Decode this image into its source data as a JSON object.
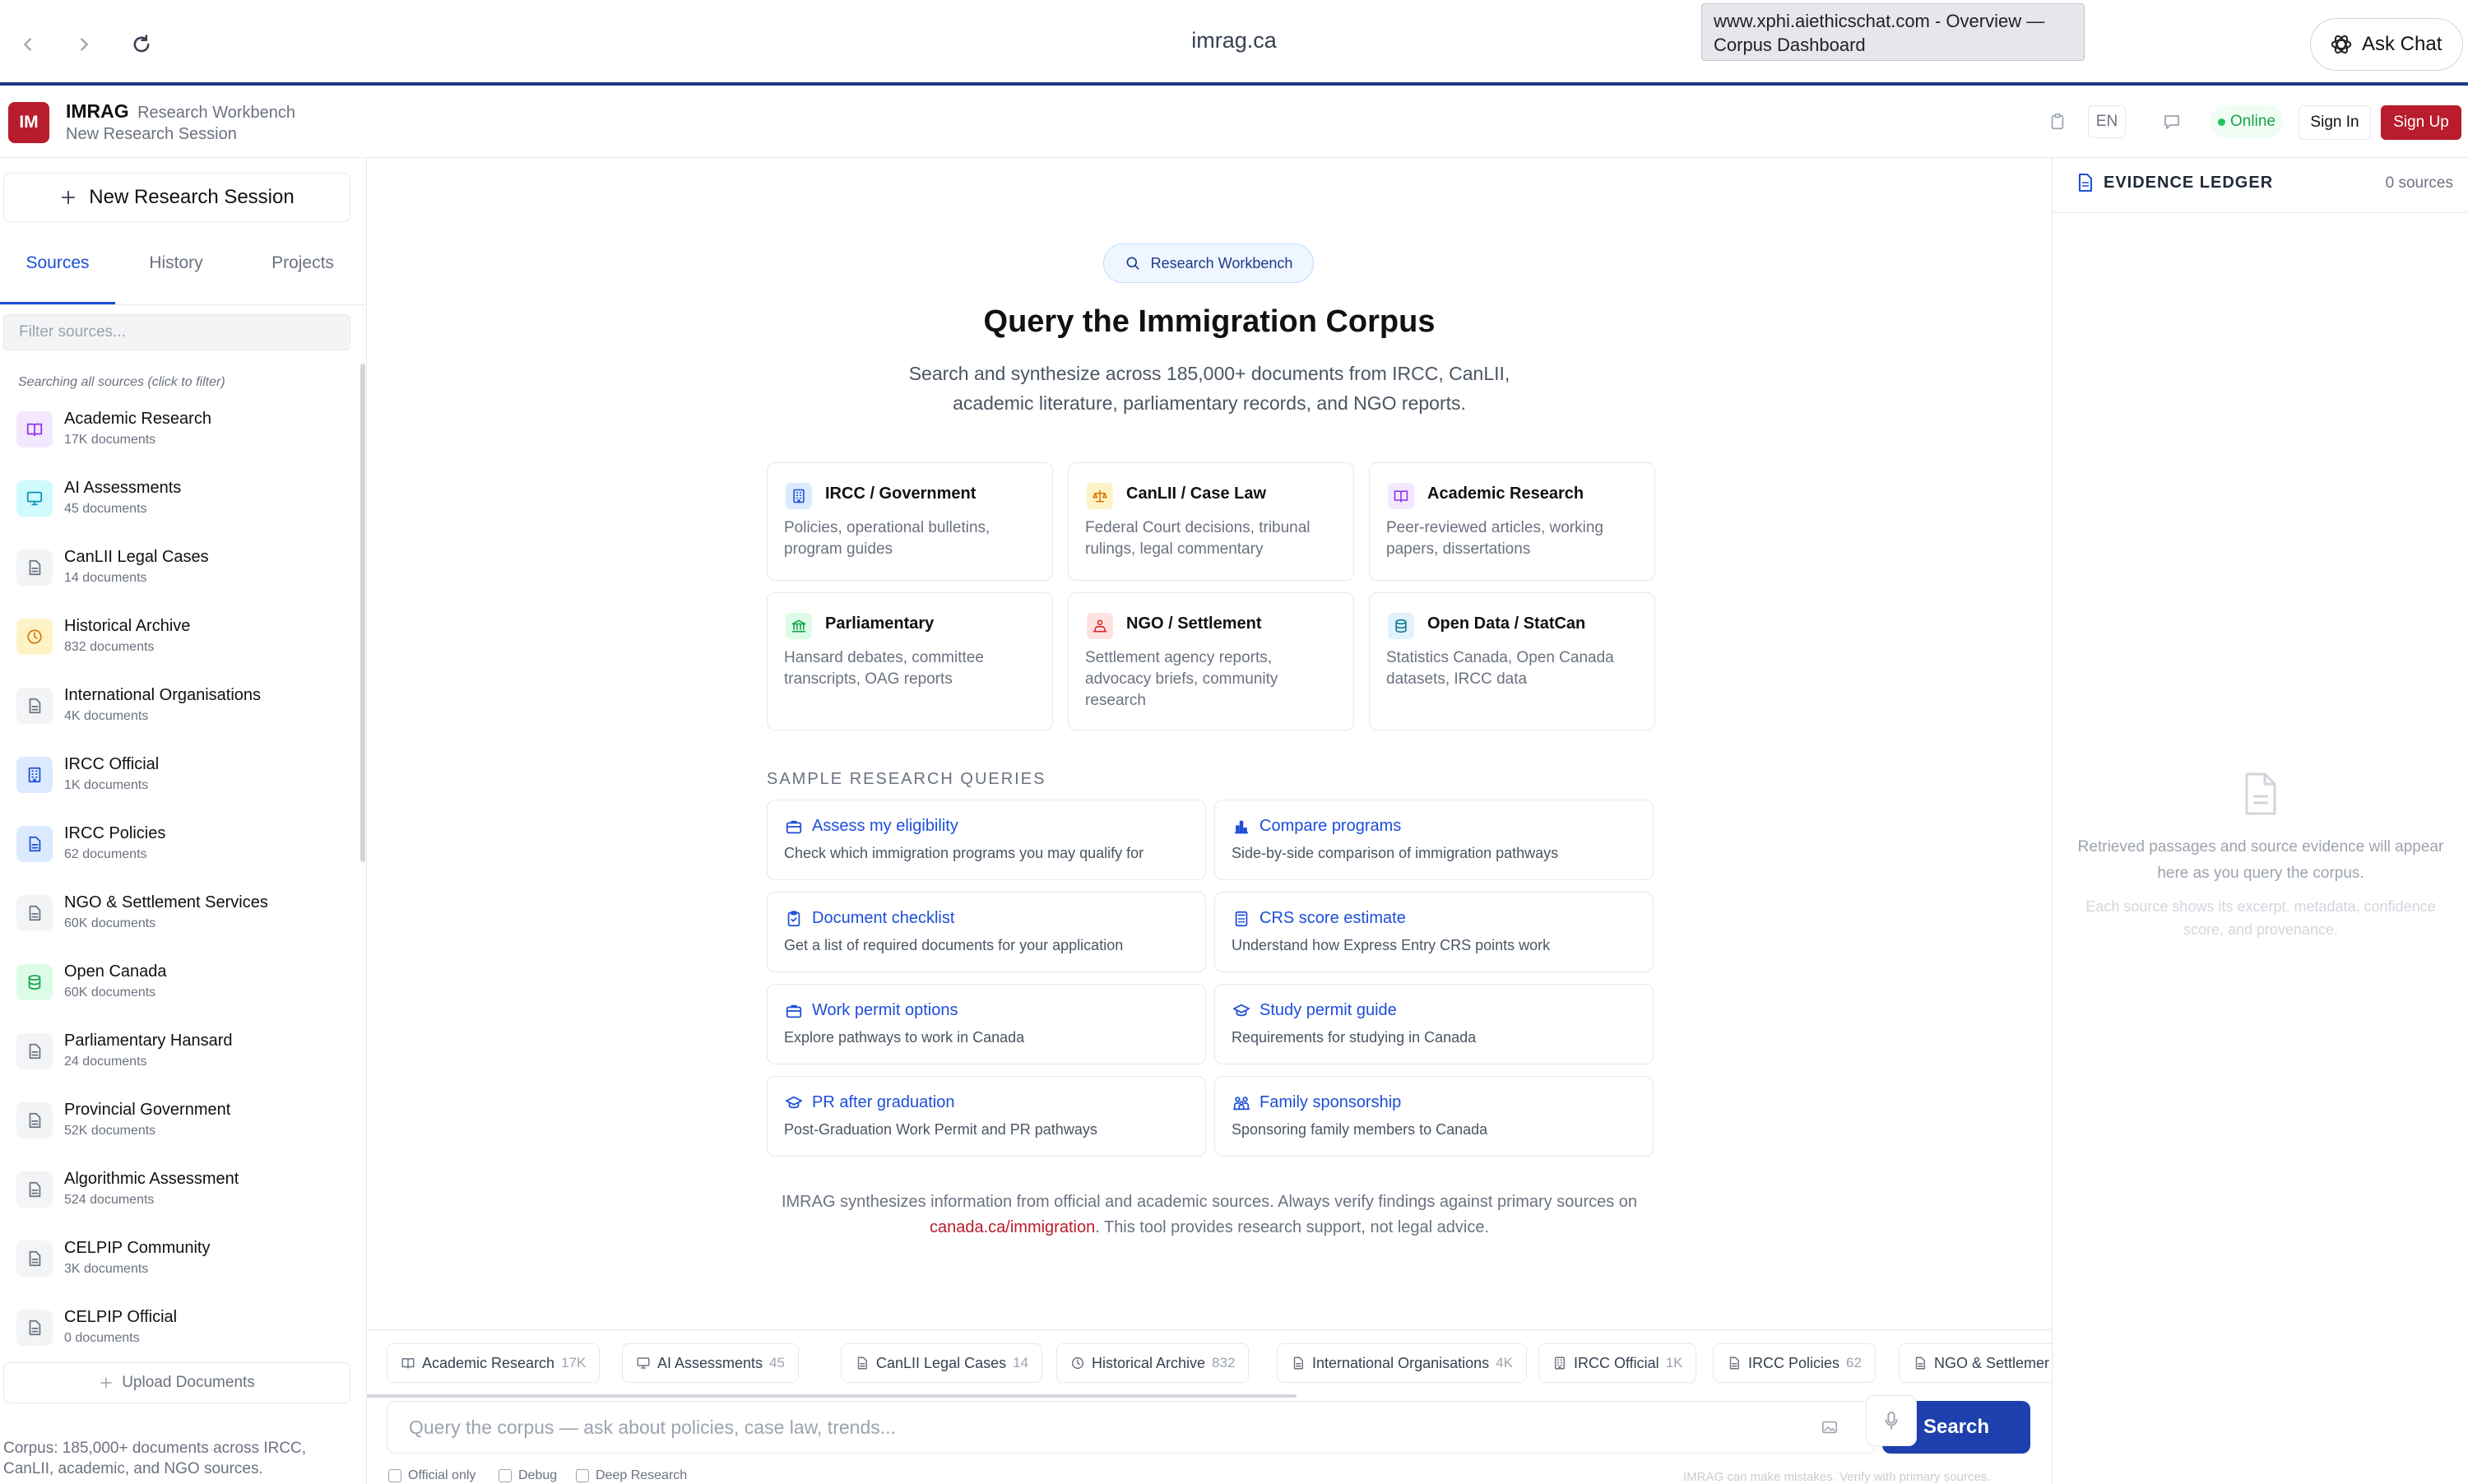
{
  "browser": {
    "url": "imrag.ca",
    "tooltip_line1": "www.xphi.aiethicschat.com - Overview —",
    "tooltip_line2": "Corpus Dashboard",
    "ask_chat_label": "Ask Chat"
  },
  "header": {
    "logo": "IM",
    "brand": "IMRAG",
    "brand_sub": "Research Workbench",
    "session_name": "New Research Session",
    "lang": "EN",
    "status": "Online",
    "sign_in": "Sign In",
    "sign_up": "Sign Up"
  },
  "sidebar": {
    "new_session_label": "New Research Session",
    "tabs": [
      "Sources",
      "History",
      "Projects"
    ],
    "filter_placeholder": "Filter sources...",
    "searching_note": "Searching all sources (click to filter)",
    "sources": [
      {
        "name": "Academic Research",
        "count": "17K documents",
        "icon": "book-icon",
        "color": "#9333ea",
        "bg": "#f3e8ff"
      },
      {
        "name": "AI Assessments",
        "count": "45 documents",
        "icon": "monitor-icon",
        "color": "#0891b2",
        "bg": "#cffafe"
      },
      {
        "name": "CanLII Legal Cases",
        "count": "14 documents",
        "icon": "document-icon",
        "color": "#6b7280",
        "bg": "#f3f4f6"
      },
      {
        "name": "Historical Archive",
        "count": "832 documents",
        "icon": "clock-icon",
        "color": "#d97706",
        "bg": "#fef3c7"
      },
      {
        "name": "International Organisations",
        "count": "4K documents",
        "icon": "document-icon",
        "color": "#6b7280",
        "bg": "#f3f4f6"
      },
      {
        "name": "IRCC Official",
        "count": "1K documents",
        "icon": "building-icon",
        "color": "#1d4ed8",
        "bg": "#dbeafe"
      },
      {
        "name": "IRCC Policies",
        "count": "62 documents",
        "icon": "document-icon",
        "color": "#1d4ed8",
        "bg": "#dbeafe"
      },
      {
        "name": "NGO & Settlement Services",
        "count": "60K documents",
        "icon": "document-icon",
        "color": "#6b7280",
        "bg": "#f3f4f6"
      },
      {
        "name": "Open Canada",
        "count": "60K documents",
        "icon": "database-icon",
        "color": "#16a34a",
        "bg": "#dcfce7"
      },
      {
        "name": "Parliamentary Hansard",
        "count": "24 documents",
        "icon": "document-icon",
        "color": "#6b7280",
        "bg": "#f3f4f6"
      },
      {
        "name": "Provincial Government",
        "count": "52K documents",
        "icon": "document-icon",
        "color": "#6b7280",
        "bg": "#f3f4f6"
      },
      {
        "name": "Algorithmic Assessment",
        "count": "524 documents",
        "icon": "document-icon",
        "color": "#6b7280",
        "bg": "#f3f4f6"
      },
      {
        "name": "CELPIP Community",
        "count": "3K documents",
        "icon": "document-icon",
        "color": "#6b7280",
        "bg": "#f3f4f6"
      },
      {
        "name": "CELPIP Official",
        "count": "0 documents",
        "icon": "document-icon",
        "color": "#6b7280",
        "bg": "#f3f4f6"
      }
    ],
    "upload_label": "Upload Documents",
    "corpus_footer": "Corpus: 185,000+ documents across IRCC, CanLII, academic, and NGO sources."
  },
  "main": {
    "pill_label": "Research Workbench",
    "title": "Query the Immigration Corpus",
    "subtitle_line1": "Search and synthesize across 185,000+ documents from IRCC, CanLII,",
    "subtitle_line2": "academic literature, parliamentary records, and NGO reports.",
    "cards": [
      {
        "title": "IRCC / Government",
        "desc": "Policies, operational bulletins, program guides",
        "icon": "building-icon",
        "color": "#1d4ed8",
        "bg": "#dbeafe"
      },
      {
        "title": "CanLII / Case Law",
        "desc": "Federal Court decisions, tribunal rulings, legal commentary",
        "icon": "scales-icon",
        "color": "#d97706",
        "bg": "#fef3c7"
      },
      {
        "title": "Academic Research",
        "desc": "Peer-reviewed articles, working papers, dissertations",
        "icon": "book-icon",
        "color": "#9333ea",
        "bg": "#f3e8ff"
      },
      {
        "title": "Parliamentary",
        "desc": "Hansard debates, committee transcripts, OAG reports",
        "icon": "landmark-icon",
        "color": "#16a34a",
        "bg": "#dcfce7"
      },
      {
        "title": "NGO / Settlement",
        "desc": "Settlement agency reports, advocacy briefs, community research",
        "icon": "people-icon",
        "color": "#dc2626",
        "bg": "#fee2e2"
      },
      {
        "title": "Open Data / StatCan",
        "desc": "Statistics Canada, Open Canada datasets, IRCC data",
        "icon": "database-icon",
        "color": "#0e7490",
        "bg": "#e0f2fe"
      }
    ],
    "sample_header": "SAMPLE RESEARCH QUERIES",
    "queries": [
      {
        "title": "Assess my eligibility",
        "desc": "Check which immigration programs you may qualify for",
        "icon": "briefcase-icon"
      },
      {
        "title": "Compare programs",
        "desc": "Side-by-side comparison of immigration pathways",
        "icon": "bar-chart-icon"
      },
      {
        "title": "Document checklist",
        "desc": "Get a list of required documents for your application",
        "icon": "clipboard-icon"
      },
      {
        "title": "CRS score estimate",
        "desc": "Understand how Express Entry CRS points work",
        "icon": "calculator-icon"
      },
      {
        "title": "Work permit options",
        "desc": "Explore pathways to work in Canada",
        "icon": "briefcase-icon"
      },
      {
        "title": "Study permit guide",
        "desc": "Requirements for studying in Canada",
        "icon": "graduation-cap-icon"
      },
      {
        "title": "PR after graduation",
        "desc": "Post-Graduation Work Permit and PR pathways",
        "icon": "graduation-cap-icon"
      },
      {
        "title": "Family sponsorship",
        "desc": "Sponsoring family members to Canada",
        "icon": "family-icon"
      }
    ],
    "disclaimer_pre": "IMRAG synthesizes information from official and academic sources. Always verify findings against primary sources on",
    "disclaimer_link": "canada.ca/immigration",
    "disclaimer_post": ". This tool provides research support, not legal advice.",
    "chips": [
      {
        "name": "Academic Research",
        "count": "17K",
        "icon": "book-icon"
      },
      {
        "name": "AI Assessments",
        "count": "45",
        "icon": "monitor-icon"
      },
      {
        "name": "CanLII Legal Cases",
        "count": "14",
        "icon": "document-icon"
      },
      {
        "name": "Historical Archive",
        "count": "832",
        "icon": "clock-icon"
      },
      {
        "name": "International Organisations",
        "count": "4K",
        "icon": "document-icon"
      },
      {
        "name": "IRCC Official",
        "count": "1K",
        "icon": "building-icon"
      },
      {
        "name": "IRCC Policies",
        "count": "62",
        "icon": "document-icon"
      },
      {
        "name": "NGO & Settlemer",
        "count": "",
        "icon": "document-icon"
      }
    ],
    "query_placeholder": "Query the corpus — ask about policies, case law, trends...",
    "search_label": "Search",
    "options": [
      "Official only",
      "Debug",
      "Deep Research"
    ],
    "mistake_note": "IMRAG can make mistakes. Verify with primary sources."
  },
  "evidence": {
    "title": "EVIDENCE LEDGER",
    "count": "0 sources",
    "empty_line1": "Retrieved passages and source evidence will appear here as you query the corpus.",
    "empty_line2": "Each source shows its excerpt, metadata, confidence score, and provenance."
  }
}
